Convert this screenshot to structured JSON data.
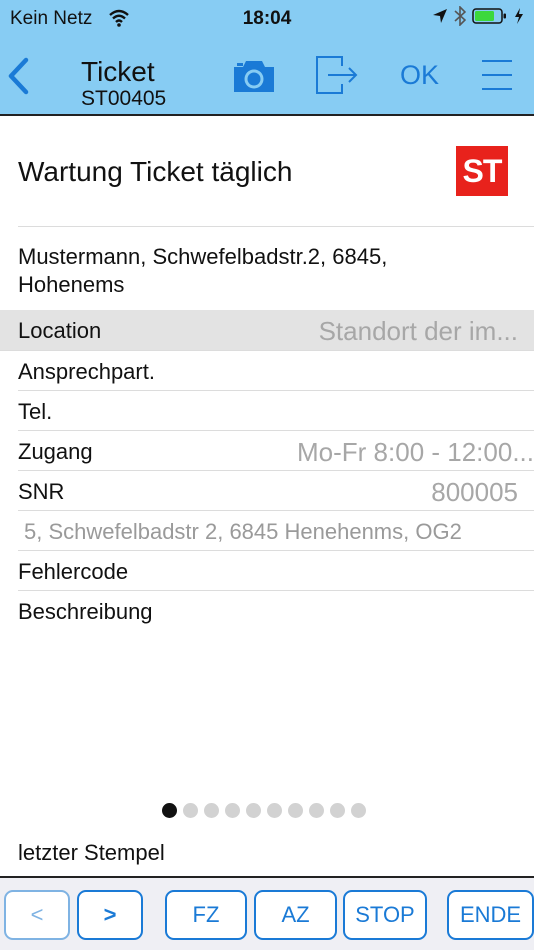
{
  "status_bar": {
    "carrier": "Kein Netz",
    "time": "18:04"
  },
  "nav": {
    "title": "Ticket",
    "subtitle": "ST00405",
    "ok_label": "OK"
  },
  "ticket": {
    "heading": "Wartung Ticket täglich",
    "logo_text": "ST",
    "logo_color": "#e8221c",
    "address_line1": "Mustermann, Schwefelbadstr.2, 6845,",
    "address_line2": "Hohenems"
  },
  "fields": {
    "location": {
      "label": "Location",
      "value": "Standort der im..."
    },
    "contact": {
      "label": "Ansprechpart."
    },
    "phone": {
      "label": "Tel."
    },
    "access": {
      "label": "Zugang",
      "value": "Mo-Fr 8:00 - 12:00..."
    },
    "snr": {
      "label": "SNR",
      "value": "800005"
    },
    "location_address": "5, Schwefelbadstr 2, 6845 Henehenms, OG2",
    "error_code": {
      "label": "Fehlercode"
    },
    "description": {
      "label": "Beschreibung"
    }
  },
  "pager": {
    "pages": 10,
    "current": 1
  },
  "last_stamp_label": "letzter Stempel",
  "toolbar": {
    "prev_label": "<",
    "next_label": ">",
    "fz_label": "FZ",
    "az_label": "AZ",
    "stop_label": "STOP",
    "end_label": "ENDE"
  },
  "colors": {
    "bar_background": "#87ccf3",
    "accent": "#1a7ad6"
  }
}
